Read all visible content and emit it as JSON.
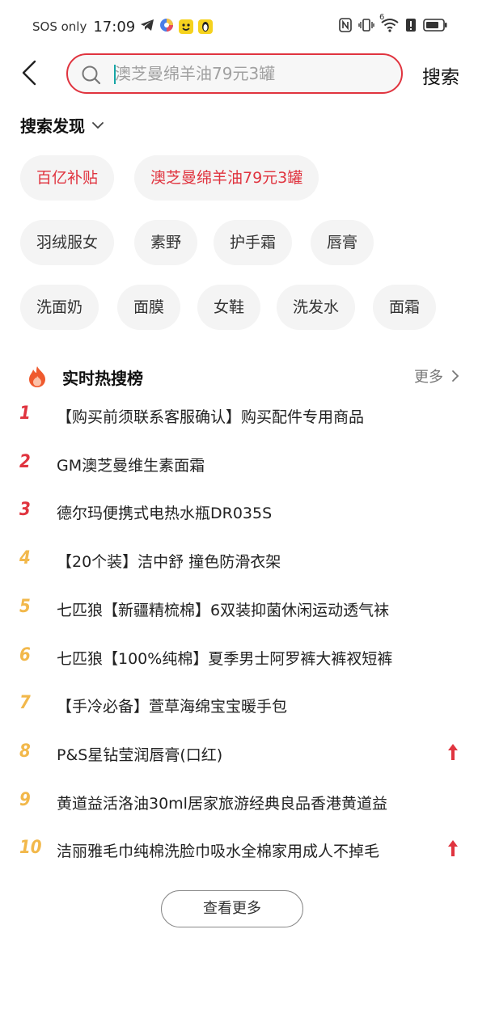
{
  "status_bar": {
    "carrier": "SOS only",
    "time": "17:09",
    "network_superscript": "6"
  },
  "search": {
    "placeholder": "澳芝曼绵羊油79元3罐",
    "value": "",
    "submit_label": "搜索",
    "accent_color": "#e0343f"
  },
  "discover": {
    "title": "搜索发现",
    "chips": [
      {
        "label": "百亿补贴",
        "highlight": true
      },
      {
        "label": "澳芝曼绵羊油79元3罐",
        "highlight": true
      },
      {
        "label": "羽绒服女",
        "highlight": false
      },
      {
        "label": "素野",
        "highlight": false
      },
      {
        "label": "护手霜",
        "highlight": false
      },
      {
        "label": "唇膏",
        "highlight": false
      },
      {
        "label": "洗面奶",
        "highlight": false
      },
      {
        "label": "面膜",
        "highlight": false
      },
      {
        "label": "女鞋",
        "highlight": false
      },
      {
        "label": "洗发水",
        "highlight": false
      },
      {
        "label": "面霜",
        "highlight": false
      }
    ]
  },
  "hot": {
    "title": "实时热搜榜",
    "more_label": "更多",
    "items": [
      {
        "rank": "1",
        "text": "【购买前须联系客服确认】购买配件专用商品",
        "trend_up": false,
        "color": "#e0343f"
      },
      {
        "rank": "2",
        "text": "GM澳芝曼维生素面霜",
        "trend_up": false,
        "color": "#e0343f"
      },
      {
        "rank": "3",
        "text": "德尔玛便携式电热水瓶DR035S",
        "trend_up": false,
        "color": "#e0343f"
      },
      {
        "rank": "4",
        "text": "【20个装】洁中舒 撞色防滑衣架",
        "trend_up": false,
        "color": "#f2b84b"
      },
      {
        "rank": "5",
        "text": "七匹狼【新疆精梳棉】6双装抑菌休闲运动透气袜",
        "trend_up": false,
        "color": "#f2b84b"
      },
      {
        "rank": "6",
        "text": "七匹狼【100%纯棉】夏季男士阿罗裤大裤衩短裤",
        "trend_up": false,
        "color": "#f2b84b"
      },
      {
        "rank": "7",
        "text": "【手冷必备】萱草海绵宝宝暖手包",
        "trend_up": false,
        "color": "#f2b84b"
      },
      {
        "rank": "8",
        "text": "P&S星钻莹润唇膏(口红)",
        "trend_up": true,
        "color": "#f2b84b"
      },
      {
        "rank": "9",
        "text": "黄道益活洛油30ml居家旅游经典良品香港黄道益",
        "trend_up": false,
        "color": "#f2b84b"
      },
      {
        "rank": "10",
        "text": "洁丽雅毛巾纯棉洗脸巾吸水全棉家用成人不掉毛",
        "trend_up": true,
        "color": "#f2b84b"
      }
    ],
    "view_more_label": "查看更多"
  }
}
